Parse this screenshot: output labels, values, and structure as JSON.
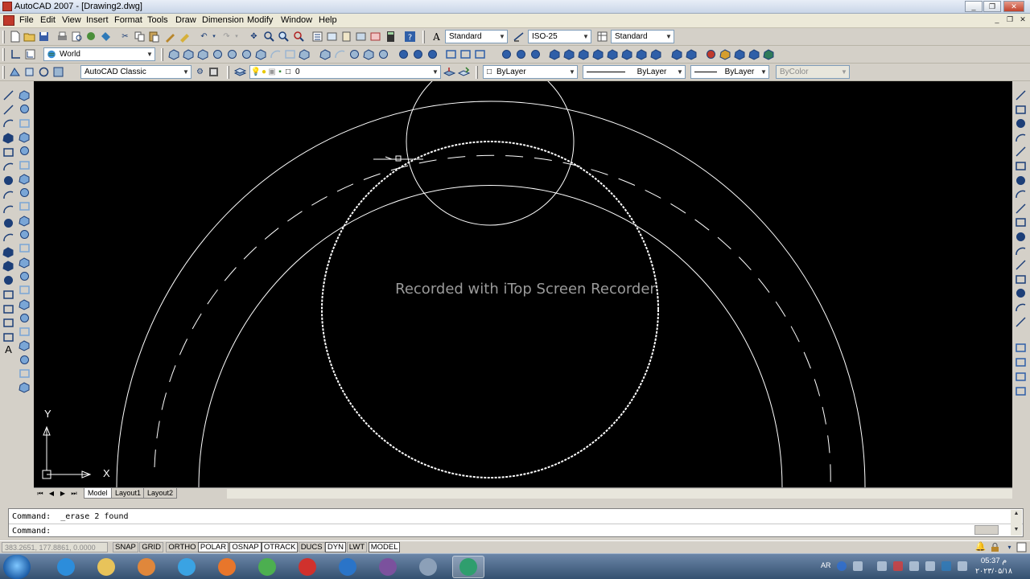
{
  "window": {
    "title": "AutoCAD 2007 - [Drawing2.dwg]",
    "minimize": "_",
    "restore": "❐",
    "close": "✕"
  },
  "menu": {
    "items": [
      "File",
      "Edit",
      "View",
      "Insert",
      "Format",
      "Tools",
      "Draw",
      "Dimension",
      "Modify",
      "Window",
      "Help"
    ]
  },
  "toolbar_styles": {
    "text_style": "Standard",
    "dim_style": "ISO-25",
    "table_style": "Standard"
  },
  "toolbar_ucs": {
    "ucs": "World"
  },
  "toolbar_workspace": {
    "workspace": "AutoCAD Classic"
  },
  "layers": {
    "current_layer": "0",
    "color": "ByLayer",
    "linetype": "ByLayer",
    "lineweight": "ByLayer",
    "plotstyle": "ByColor"
  },
  "viewport": {
    "watermark": "Recorded with iTop Screen Recorder",
    "ucs_x": "X",
    "ucs_y": "Y"
  },
  "layout_tabs": {
    "tabs": [
      "Model",
      "Layout1",
      "Layout2"
    ],
    "active": "Model"
  },
  "command": {
    "history": "Command:  _erase 2 found",
    "prompt": "Command:"
  },
  "status": {
    "coordinates": "383.2651, 177.8861, 0.0000",
    "toggles": [
      {
        "label": "SNAP",
        "on": false
      },
      {
        "label": "GRID",
        "on": false
      },
      {
        "label": "ORTHO",
        "on": false
      },
      {
        "label": "POLAR",
        "on": true
      },
      {
        "label": "OSNAP",
        "on": true
      },
      {
        "label": "OTRACK",
        "on": true
      },
      {
        "label": "DUCS",
        "on": false
      },
      {
        "label": "DYN",
        "on": true
      },
      {
        "label": "LWT",
        "on": false
      },
      {
        "label": "MODEL",
        "on": true
      }
    ]
  },
  "taskbar": {
    "apps": [
      {
        "name": "internet-explorer-icon",
        "color": "#2c8ddb"
      },
      {
        "name": "file-explorer-icon",
        "color": "#e8c35a"
      },
      {
        "name": "media-player-icon",
        "color": "#e0873b"
      },
      {
        "name": "skype-icon",
        "color": "#3aa3e3"
      },
      {
        "name": "firefox-icon",
        "color": "#e8762b"
      },
      {
        "name": "chrome-icon",
        "color": "#4caf50"
      },
      {
        "name": "screen-recorder-icon",
        "color": "#d0312d"
      },
      {
        "name": "phone-icon",
        "color": "#2a74c8"
      },
      {
        "name": "viber-icon",
        "color": "#7b519d"
      },
      {
        "name": "calculator-icon",
        "color": "#8ca0b8"
      },
      {
        "name": "autocad-icon",
        "color": "#2f9e6e"
      }
    ],
    "active_app": "autocad-icon",
    "language": "AR",
    "time": "05:37 م",
    "date": "۲۰۲۳/۰۵/۱۸"
  },
  "colors": {
    "drawing_background": "#000000",
    "geometry": "#ffffff",
    "dialog_bg": "#d4d0c8"
  }
}
